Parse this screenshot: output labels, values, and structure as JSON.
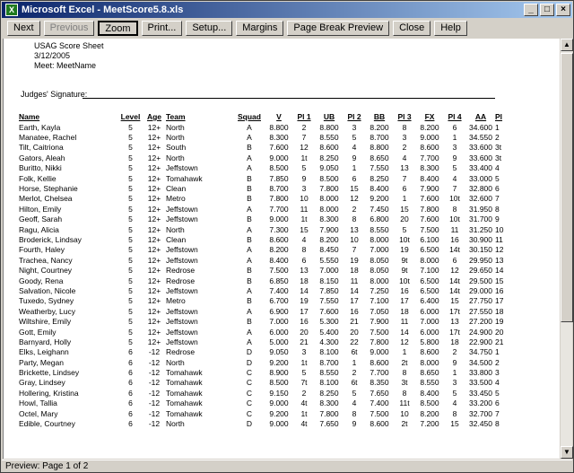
{
  "window": {
    "title": "Microsoft Excel - MeetScore5.8.xls",
    "buttons": [
      "_",
      "□",
      "×"
    ]
  },
  "toolbar": {
    "next": "Next",
    "previous": "Previous",
    "zoom": "Zoom",
    "print": "Print...",
    "setup": "Setup...",
    "margins": "Margins",
    "page_break_preview": "Page Break Preview",
    "close": "Close",
    "help": "Help"
  },
  "sheet": {
    "title": "USAG Score Sheet",
    "date": "3/12/2005",
    "meet": "Meet: MeetName",
    "signature_label": "Judges' Signature:",
    "columns": [
      "Name",
      "Level",
      "Age",
      "Team",
      "Squad",
      "V",
      "Pl 1",
      "UB",
      "Pl 2",
      "BB",
      "Pl 3",
      "FX",
      "Pl 4",
      "AA",
      "Pl"
    ],
    "rows": [
      [
        "Earth, Kayla",
        "5",
        "12+",
        "North",
        "A",
        "8.800",
        "2",
        "8.800",
        "3",
        "8.200",
        "8",
        "8.200",
        "6",
        "34.600",
        "1"
      ],
      [
        "Manatee, Rachel",
        "5",
        "12+",
        "North",
        "A",
        "8.300",
        "7",
        "8.550",
        "5",
        "8.700",
        "3",
        "9.000",
        "1",
        "34.550",
        "2"
      ],
      [
        "Tilt, Caitriona",
        "5",
        "12+",
        "South",
        "B",
        "7.600",
        "12",
        "8.600",
        "4",
        "8.800",
        "2",
        "8.600",
        "3",
        "33.600",
        "3t"
      ],
      [
        "Gators, Aleah",
        "5",
        "12+",
        "North",
        "A",
        "9.000",
        "1t",
        "8.250",
        "9",
        "8.650",
        "4",
        "7.700",
        "9",
        "33.600",
        "3t"
      ],
      [
        "Buritto, Nikki",
        "5",
        "12+",
        "Jeffstown",
        "A",
        "8.500",
        "5",
        "9.050",
        "1",
        "7.550",
        "13",
        "8.300",
        "5",
        "33.400",
        "4"
      ],
      [
        "Folk, Kellie",
        "5",
        "12+",
        "Tomahawk",
        "B",
        "7.850",
        "9",
        "8.500",
        "6",
        "8.250",
        "7",
        "8.400",
        "4",
        "33.000",
        "5"
      ],
      [
        "Horse, Stephanie",
        "5",
        "12+",
        "Clean",
        "B",
        "8.700",
        "3",
        "7.800",
        "15",
        "8.400",
        "6",
        "7.900",
        "7",
        "32.800",
        "6"
      ],
      [
        "Merlot, Chelsea",
        "5",
        "12+",
        "Metro",
        "B",
        "7.800",
        "10",
        "8.000",
        "12",
        "9.200",
        "1",
        "7.600",
        "10t",
        "32.600",
        "7"
      ],
      [
        "Hilton, Emily",
        "5",
        "12+",
        "Jeffstown",
        "A",
        "7.700",
        "11",
        "8.000",
        "2",
        "7.450",
        "15",
        "7.800",
        "8",
        "31.950",
        "8"
      ],
      [
        "Geoff, Sarah",
        "5",
        "12+",
        "Jeffstown",
        "B",
        "9.000",
        "1t",
        "8.300",
        "8",
        "6.800",
        "20",
        "7.600",
        "10t",
        "31.700",
        "9"
      ],
      [
        "Ragu, Alicia",
        "5",
        "12+",
        "North",
        "A",
        "7.300",
        "15",
        "7.900",
        "13",
        "8.550",
        "5",
        "7.500",
        "11",
        "31.250",
        "10"
      ],
      [
        "Broderick, Lindsay",
        "5",
        "12+",
        "Clean",
        "B",
        "8.600",
        "4",
        "8.200",
        "10",
        "8.000",
        "10t",
        "6.100",
        "16",
        "30.900",
        "11"
      ],
      [
        "Fourth, Haley",
        "5",
        "12+",
        "Jeffstown",
        "A",
        "8.200",
        "8",
        "8.450",
        "7",
        "7.000",
        "19",
        "6.500",
        "14t",
        "30.150",
        "12"
      ],
      [
        "Trachea, Nancy",
        "5",
        "12+",
        "Jeffstown",
        "A",
        "8.400",
        "6",
        "5.550",
        "19",
        "8.050",
        "9t",
        "8.000",
        "6",
        "29.950",
        "13"
      ],
      [
        "Night, Courtney",
        "5",
        "12+",
        "Redrose",
        "B",
        "7.500",
        "13",
        "7.000",
        "18",
        "8.050",
        "9t",
        "7.100",
        "12",
        "29.650",
        "14"
      ],
      [
        "Goody, Rena",
        "5",
        "12+",
        "Redrose",
        "B",
        "6.850",
        "18",
        "8.150",
        "11",
        "8.000",
        "10t",
        "6.500",
        "14t",
        "29.500",
        "15"
      ],
      [
        "Salvation, Nicole",
        "5",
        "12+",
        "Jeffstown",
        "A",
        "7.400",
        "14",
        "7.850",
        "14",
        "7.250",
        "16",
        "6.500",
        "14t",
        "29.000",
        "16"
      ],
      [
        "Tuxedo, Sydney",
        "5",
        "12+",
        "Metro",
        "B",
        "6.700",
        "19",
        "7.550",
        "17",
        "7.100",
        "17",
        "6.400",
        "15",
        "27.750",
        "17"
      ],
      [
        "Weatherby, Lucy",
        "5",
        "12+",
        "Jeffstown",
        "A",
        "6.900",
        "17",
        "7.600",
        "16",
        "7.050",
        "18",
        "6.000",
        "17t",
        "27.550",
        "18"
      ],
      [
        "Wiltshire, Emily",
        "5",
        "12+",
        "Jeffstown",
        "B",
        "7.000",
        "16",
        "5.300",
        "21",
        "7.900",
        "11",
        "7.000",
        "13",
        "27.200",
        "19"
      ],
      [
        "Gott, Emily",
        "5",
        "12+",
        "Jeffstown",
        "A",
        "6.000",
        "20",
        "5.400",
        "20",
        "7.500",
        "14",
        "6.000",
        "17t",
        "24.900",
        "20"
      ],
      [
        "Barnyard, Holly",
        "5",
        "12+",
        "Jeffstown",
        "A",
        "5.000",
        "21",
        "4.300",
        "22",
        "7.800",
        "12",
        "5.800",
        "18",
        "22.900",
        "21"
      ],
      [
        "Elks, Leighann",
        "6",
        "-12",
        "Redrose",
        "D",
        "9.050",
        "3",
        "8.100",
        "6t",
        "9.000",
        "1",
        "8.600",
        "2",
        "34.750",
        "1"
      ],
      [
        "Party, Megan",
        "6",
        "-12",
        "North",
        "D",
        "9.200",
        "1t",
        "8.700",
        "1",
        "8.600",
        "2t",
        "8.000",
        "9",
        "34.500",
        "2"
      ],
      [
        "Brickette, Lindsey",
        "6",
        "-12",
        "Tomahawk",
        "C",
        "8.900",
        "5",
        "8.550",
        "2",
        "7.700",
        "8",
        "8.650",
        "1",
        "33.800",
        "3"
      ],
      [
        "Gray, Lindsey",
        "6",
        "-12",
        "Tomahawk",
        "C",
        "8.500",
        "7t",
        "8.100",
        "6t",
        "8.350",
        "3t",
        "8.550",
        "3",
        "33.500",
        "4"
      ],
      [
        "Hollering, Kristina",
        "6",
        "-12",
        "Tomahawk",
        "C",
        "9.150",
        "2",
        "8.250",
        "5",
        "7.650",
        "8",
        "8.400",
        "5",
        "33.450",
        "5"
      ],
      [
        "Howl, Tallia",
        "6",
        "-12",
        "Tomahawk",
        "C",
        "9.000",
        "4t",
        "8.300",
        "4",
        "7.400",
        "11t",
        "8.500",
        "4",
        "33.200",
        "6"
      ],
      [
        "Octel, Mary",
        "6",
        "-12",
        "Tomahawk",
        "C",
        "9.200",
        "1t",
        "7.800",
        "8",
        "7.500",
        "10",
        "8.200",
        "8",
        "32.700",
        "7"
      ],
      [
        "Edible, Courtney",
        "6",
        "-12",
        "North",
        "D",
        "9.000",
        "4t",
        "7.650",
        "9",
        "8.600",
        "2t",
        "7.200",
        "15",
        "32.450",
        "8"
      ]
    ]
  },
  "status": {
    "text": "Preview: Page 1 of 2"
  }
}
